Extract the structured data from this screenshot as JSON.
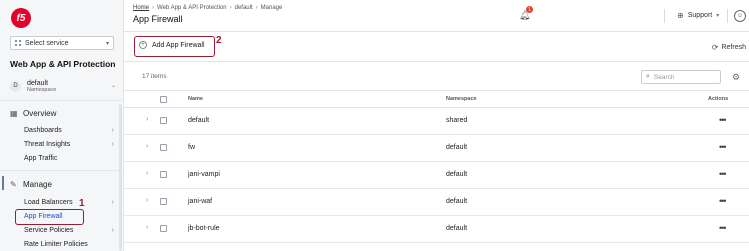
{
  "sidebar": {
    "logo_text": "f5",
    "select_service": "Select service",
    "workspace_title": "Web App & API Protection",
    "namespace": {
      "avatar": "D",
      "name": "default",
      "label": "Namespace"
    },
    "sections": [
      {
        "title": "Overview",
        "icon": "overview-icon",
        "items": [
          {
            "label": "Dashboards",
            "arrow": "›"
          },
          {
            "label": "Threat Insights",
            "arrow": "›"
          },
          {
            "label": "App Traffic",
            "arrow": ""
          }
        ]
      },
      {
        "title": "Manage",
        "icon": "wrench-icon",
        "items": [
          {
            "label": "Load Balancers",
            "arrow": "›"
          },
          {
            "label": "App Firewall",
            "arrow": ""
          },
          {
            "label": "Service Policies",
            "arrow": "›"
          },
          {
            "label": "Rate Limiter Policies",
            "arrow": ""
          }
        ]
      }
    ]
  },
  "topbar": {
    "breadcrumb": [
      "Home",
      "Web App & API Protection",
      "default",
      "Manage"
    ],
    "title": "App Firewall",
    "notification_count": "1",
    "support_label": "Support"
  },
  "actions": {
    "add_label": "Add App Firewall",
    "refresh_label": "Refresh"
  },
  "table": {
    "count_label": "17 items",
    "search_placeholder": "Search",
    "columns": {
      "name": "Name",
      "namespace": "Namespace",
      "actions": "Actions"
    },
    "rows": [
      {
        "name": "default",
        "namespace": "shared"
      },
      {
        "name": "fw",
        "namespace": "default"
      },
      {
        "name": "jani-vampi",
        "namespace": "default"
      },
      {
        "name": "jani-waf",
        "namespace": "default"
      },
      {
        "name": "jb-bot-rule",
        "namespace": "default"
      }
    ]
  },
  "annotations": {
    "one": "1",
    "two": "2"
  },
  "colors": {
    "brand": "#e4002b",
    "annotation": "#9b1b30"
  }
}
